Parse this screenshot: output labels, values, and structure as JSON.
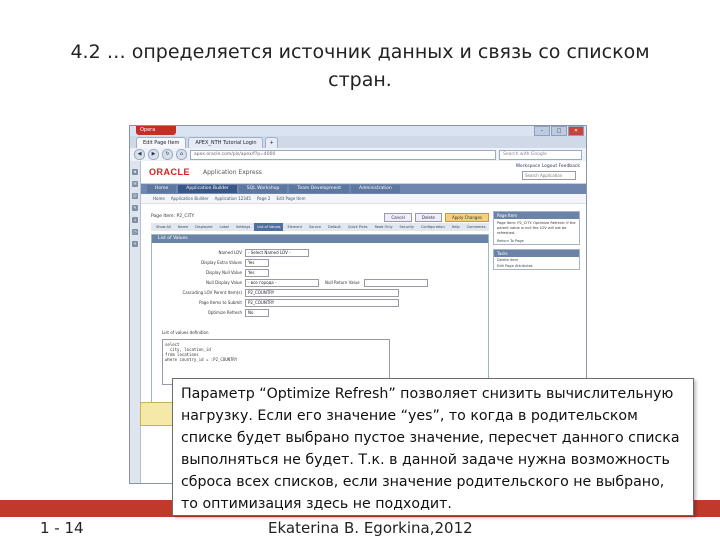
{
  "slide": {
    "title": "4.2 … определяется источник данных и связь со списком стран.",
    "footer_number": "1 - 14",
    "footer_author": "Ekaterina B. Egorkina,2012"
  },
  "callout": {
    "text": "Параметр “Optimize Refresh” позволяет снизить вычислительную нагрузку. Если его значение “yes”, то когда в родительском списке будет выбрано пустое значение, пересчет данного списка выполняться не будет. Т.к. в данной задаче нужна возможность сброса всех списков, если значение родительского не выбрано, то оптимизация здесь не подходит."
  },
  "browser": {
    "menu_label": "Opera",
    "tabs": [
      "Edit Page Item",
      "APEX_NTH Tutorial Login",
      "+"
    ],
    "url": "apex.oracle.com/pls/apex/f?p=4000",
    "search_placeholder": "Search with Google",
    "brand": "ORACLE",
    "product": "Application Express",
    "header_links": "Workspace   Logout   Feedback",
    "header_search": "Search Application",
    "app_tabs": [
      "Home",
      "Application Builder",
      "SQL Workshop",
      "Team Development",
      "Administration"
    ],
    "crumbs": [
      "Home",
      "Application Builder",
      "Application 12345",
      "Page 2",
      "Edit Page Item"
    ],
    "page_item": "Page Item: P2_CITY",
    "actions": [
      "Cancel",
      "Delete",
      "Apply Changes"
    ],
    "subtabs": [
      "Show All",
      "Name",
      "Displayed",
      "Label",
      "Settings",
      "List of Values",
      "Element",
      "Source",
      "Default",
      "Quick Picks",
      "Read Only",
      "Security",
      "Configuration",
      "Help",
      "Comments"
    ],
    "lov_title": "List of Values",
    "lov_fields": [
      {
        "label": "Named LOV",
        "value": "- Select Named LOV -"
      },
      {
        "label": "Display Extra Values",
        "value": "Yes"
      },
      {
        "label": "Display Null Value",
        "value": "Yes"
      },
      {
        "label": "Null Display Value",
        "value": "- все города -"
      },
      {
        "label": "Cascading LOV Parent Item(s)",
        "value": "P2_COUNTRY"
      },
      {
        "label": "Page Items to Submit",
        "value": "P2_COUNTRY"
      },
      {
        "label": "Optimize Refresh",
        "value": "No"
      }
    ],
    "null_return_label": "Null Return Value",
    "sql_label": "List of values definition",
    "sql_text": "select\n  city, location_id\nfrom locations\nwhere country_id = :P2_COUNTRY",
    "right_panel": {
      "page_item_head": "Page Item",
      "page_item_text": "Page Item: P2_CITY. Optimize Refresh: if the parent value is null the LOV will not be refreshed.",
      "return_label": "Return To Page",
      "tasks_head": "Tasks",
      "tasks": [
        "Delete item",
        "Edit Page Attributes"
      ]
    }
  }
}
